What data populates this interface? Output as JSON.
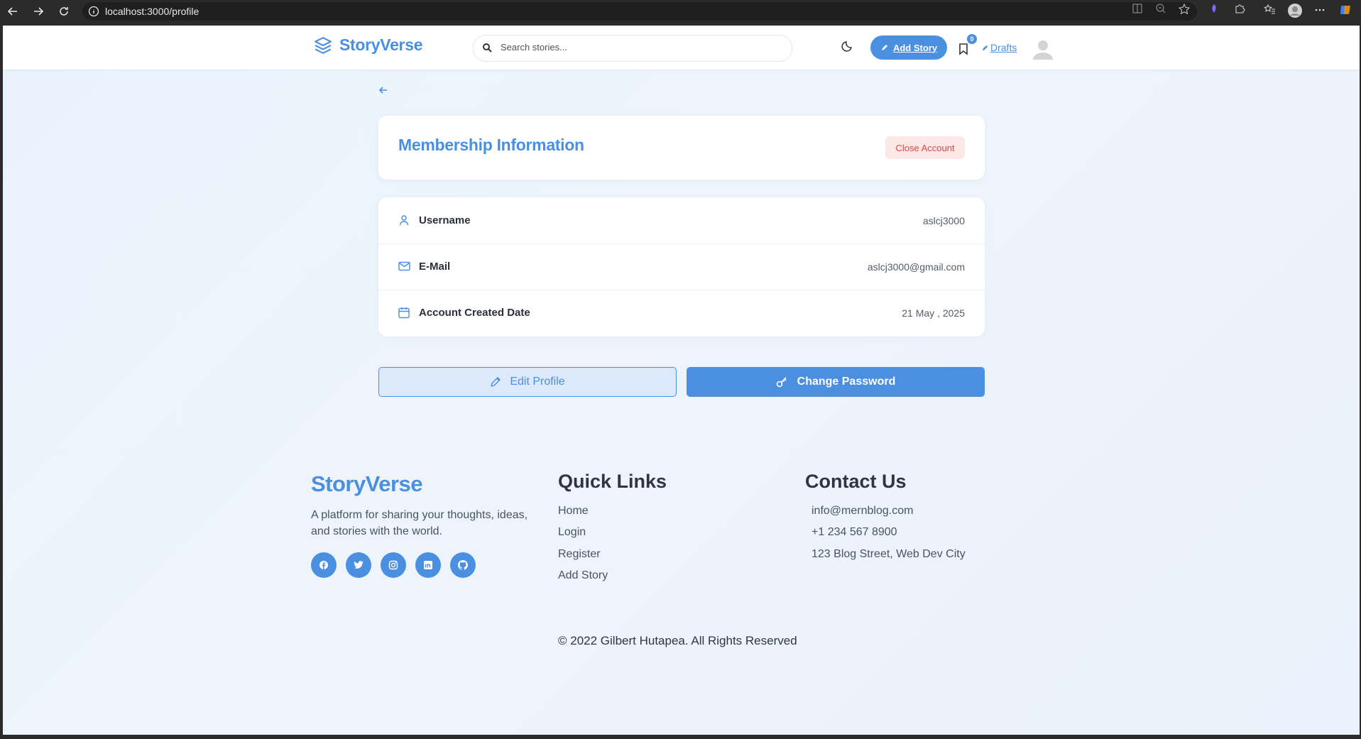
{
  "browser": {
    "url": "localhost:3000/profile"
  },
  "header": {
    "brand": "StoryVerse",
    "search_placeholder": "Search stories...",
    "add_story_label": "Add Story",
    "bookmark_count": "0",
    "drafts_label": "Drafts"
  },
  "membership": {
    "title": "Membership Information",
    "close_account_label": "Close Account",
    "rows": [
      {
        "label": "Username",
        "value": "aslcj3000"
      },
      {
        "label": "E-Mail",
        "value": "aslcj3000@gmail.com"
      },
      {
        "label": "Account Created Date",
        "value": "21 May , 2025"
      }
    ]
  },
  "actions": {
    "edit_profile": "Edit Profile",
    "change_password": "Change Password"
  },
  "footer": {
    "brand": "StoryVerse",
    "description": "A platform for sharing your thoughts, ideas, and stories with the world.",
    "quick_links_title": "Quick Links",
    "quick_links": [
      "Home",
      "Login",
      "Register",
      "Add Story"
    ],
    "contact_title": "Contact Us",
    "contact": [
      "info@mernblog.com",
      "+1 234 567 8900",
      "123 Blog Street, Web Dev City"
    ],
    "copyright": "© 2022 Gilbert Hutapea. All Rights Reserved",
    "socials": [
      "facebook-icon",
      "twitter-icon",
      "instagram-icon",
      "linkedin-icon",
      "github-icon"
    ]
  },
  "colors": {
    "accent": "#4a8fe0",
    "danger": "#e04848"
  }
}
